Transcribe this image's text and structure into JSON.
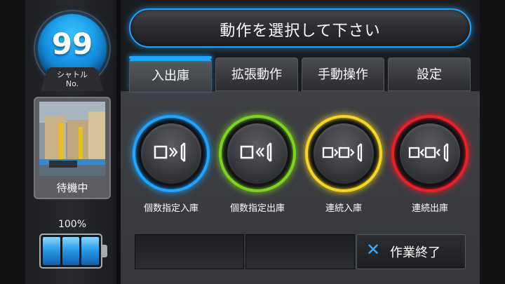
{
  "shuttle": {
    "number": "99",
    "label_line1": "シャトル",
    "label_line2": "No."
  },
  "status": {
    "text": "待機中"
  },
  "battery": {
    "percent_text": "100%",
    "level": 1.0
  },
  "header": {
    "title": "動作を選択して下さい"
  },
  "tabs": [
    {
      "label": "入出庫",
      "active": true
    },
    {
      "label": "拡張動作",
      "active": false
    },
    {
      "label": "手動操作",
      "active": false
    },
    {
      "label": "設定",
      "active": false
    }
  ],
  "actions": [
    {
      "label": "個数指定入庫",
      "color": "#1ea4ff",
      "icon": "store-in-icon"
    },
    {
      "label": "個数指定出庫",
      "color": "#7ed321",
      "icon": "retrieve-icon"
    },
    {
      "label": "連続入庫",
      "color": "#f5d623",
      "icon": "continuous-store-in-icon"
    },
    {
      "label": "連続出庫",
      "color": "#e8202a",
      "icon": "continuous-retrieve-icon"
    }
  ],
  "footer": {
    "finish_label": "作業終了",
    "finish_icon": "close-icon"
  }
}
